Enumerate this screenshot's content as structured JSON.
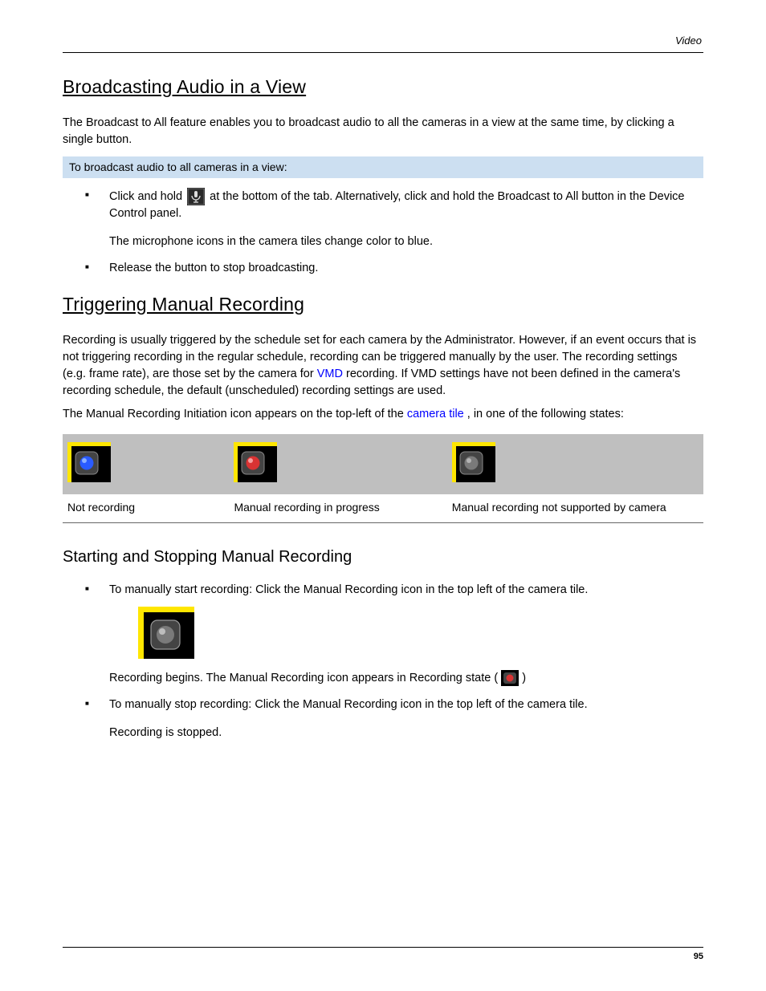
{
  "header": {
    "section": "Video"
  },
  "s1": {
    "title": "Broadcasting Audio in a View",
    "p1": "The Broadcast to All feature enables you to broadcast audio to all the cameras in a view at the same time, by clicking a single button.",
    "note": "To broadcast audio to all cameras in a view:",
    "li1_pre": "Click and hold ",
    "li1_post": " at the bottom of the tab. Alternatively, click and hold the Broadcast to All button in the Device Control panel.",
    "li1_extra": "The microphone icons in the camera tiles change color to blue.",
    "li2": "Release the button to stop broadcasting."
  },
  "s2": {
    "title": "Triggering Manual Recording",
    "p1_a": "Recording is usually triggered by the schedule set for each camera by the Administrator. However, if an event occurs that is not triggering recording in the regular schedule, recording can be triggered manually by the user. The recording settings (e.g. frame rate), are those set by the camera for ",
    "p1_link1": "VMD",
    "p1_b": " recording. If VMD settings have not been defined in the camera's recording schedule, the default (unscheduled) recording settings are used.",
    "p2_a": "The Manual Recording Initiation icon appears on the top-left of the ",
    "p2_link2": "camera tile",
    "p2_b": ", in one of the following states:",
    "table": {
      "cols": [
        {
          "label": "Not recording"
        },
        {
          "label": "Manual recording in progress"
        },
        {
          "label": "Manual recording not supported by camera"
        }
      ]
    }
  },
  "s3": {
    "title": "Starting and Stopping Manual Recording",
    "li1": "To manually start recording: Click the Manual Recording icon in the top left of the camera tile.",
    "li1_extra_a": "Recording begins. The Manual Recording icon appears in Recording state (",
    "li1_extra_b": ")",
    "li2": "To manually stop recording: Click the Manual Recording icon in the top left of the camera tile.",
    "li2_extra": "Recording is stopped."
  },
  "footer": {
    "page": "95"
  }
}
